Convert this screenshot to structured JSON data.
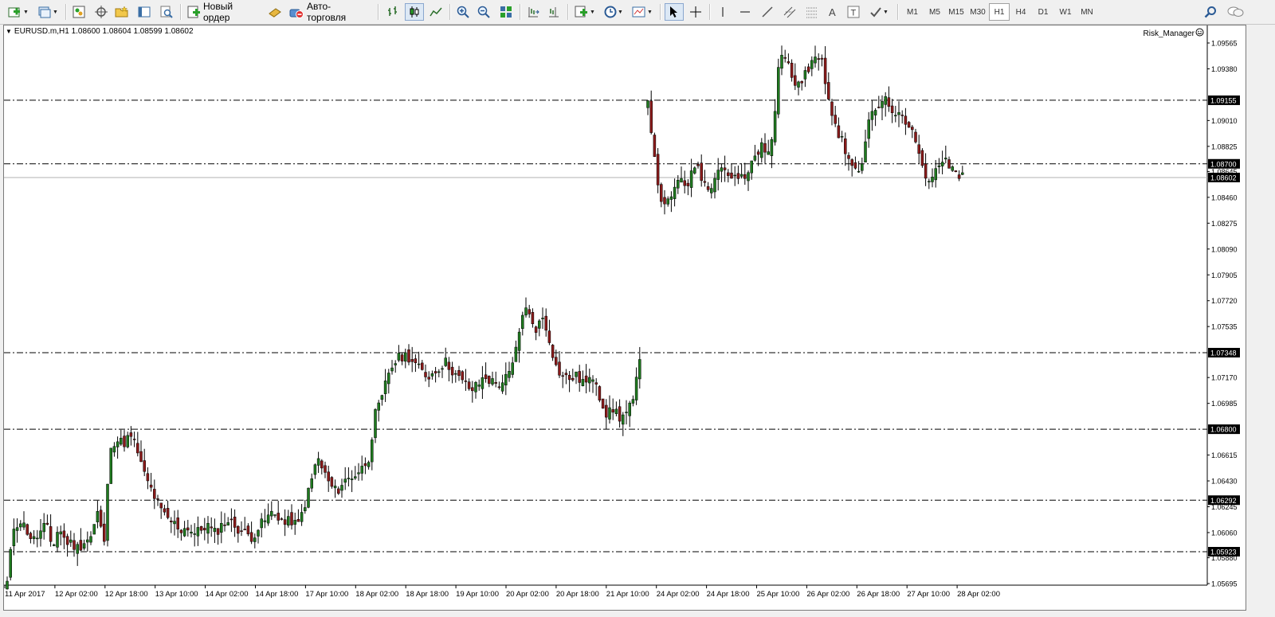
{
  "toolbar": {
    "new_order_label": "Новый ордер",
    "autotrading_label": "Авто-торговля",
    "timeframes": [
      "M1",
      "M5",
      "M15",
      "M30",
      "H1",
      "H4",
      "D1",
      "W1",
      "MN"
    ],
    "active_timeframe": "H1"
  },
  "chart": {
    "symbol_info": "EURUSD.m,H1  1.08600 1.08604 1.08599 1.08602",
    "indicator_label": "Risk_Manager",
    "price_labels": [
      "1.09565",
      "1.09380",
      "1.09010",
      "1.08825",
      "1.08645",
      "1.08460",
      "1.08275",
      "1.08090",
      "1.07905",
      "1.07720",
      "1.07535",
      "1.07170",
      "1.06985",
      "1.06615",
      "1.06430",
      "1.06245",
      "1.06060",
      "1.05880",
      "1.05695"
    ],
    "level_labels": [
      "1.09155",
      "1.08700",
      "1.07348",
      "1.06800",
      "1.06292",
      "1.05923"
    ],
    "current_price": "1.08602",
    "time_labels": [
      "11 Apr 2017",
      "12 Apr 02:00",
      "12 Apr 18:00",
      "13 Apr 10:00",
      "14 Apr 02:00",
      "14 Apr 18:00",
      "17 Apr 10:00",
      "18 Apr 02:00",
      "18 Apr 18:00",
      "19 Apr 10:00",
      "20 Apr 02:00",
      "20 Apr 18:00",
      "21 Apr 10:00",
      "24 Apr 02:00",
      "24 Apr 18:00",
      "25 Apr 10:00",
      "26 Apr 02:00",
      "26 Apr 18:00",
      "27 Apr 10:00",
      "28 Apr 02:00"
    ],
    "colors": {
      "bull_candle": "#1f7a1f",
      "bear_candle": "#8b1a1a",
      "wick": "#000000",
      "level_line": "#000000",
      "current_price_line": "#b0b0b0",
      "price_tag_bg": "#000000",
      "price_tag_text": "#ffffff"
    }
  },
  "chart_data": {
    "type": "candlestick",
    "symbol": "EURUSD.m",
    "timeframe": "H1",
    "ylim": [
      1.05695,
      1.09565
    ],
    "key_prices": [
      1.0567,
      1.0675,
      1.0595,
      1.0673,
      1.0735,
      1.0768,
      1.0695,
      1.073,
      1.0915,
      1.085,
      1.086,
      1.0955,
      1.092,
      1.087,
      1.08602
    ],
    "horizontal_levels": [
      1.09155,
      1.087,
      1.07348,
      1.068,
      1.06292,
      1.05923
    ],
    "last_price": 1.08602
  }
}
